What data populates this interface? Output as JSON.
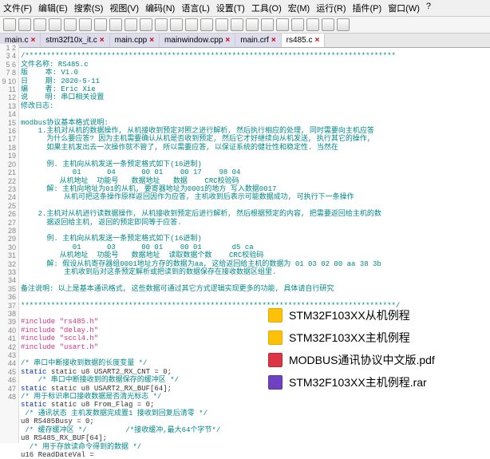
{
  "menu": {
    "file": "文件(F)",
    "edit": "编辑(E)",
    "search": "搜索(S)",
    "view": "视图(V)",
    "encoding": "编码(N)",
    "language": "语言(L)",
    "settings": "设置(T)",
    "tools": "工具(O)",
    "macro": "宏(M)",
    "run": "运行(R)",
    "plugin": "插件(P)",
    "window": "窗口(W)",
    "help": "?"
  },
  "tabs": [
    {
      "label": "main.c"
    },
    {
      "label": "stm32f10x_it.c"
    },
    {
      "label": "main.cpp"
    },
    {
      "label": "mainwindow.cpp"
    },
    {
      "label": "main.crf"
    },
    {
      "label": "rs485.c",
      "active": true
    }
  ],
  "code": {
    "header_line": "/**************************************************************************************",
    "h1": "文件名称: RS485.c",
    "h2": "版    本: V1.0",
    "h3": "日    期: 2020-5-11",
    "h4": "编    者: Eric Xie",
    "h5": "说    明: 串口相关设置",
    "h6": "修改日志:",
    "hm1": "modbus协议基本格式说明:",
    "hm2": "    1.主机对从机的数据操作, 从机接收到预定对照之进行解析, 然后执行相应的处理, 同时需要向主机应答",
    "hm3": "      为什么要应答? 因为主机需要确认从机是否收到预定, 然后它才好继续向从机发送, 执行其它的操作,",
    "hm4": "      如果主机发出去一次操作就不管了, 所以需要应答, 以保证系统的健壮性和稳定性. 当然在",
    "hm6": "      例. 主机向从机发送一条预定格式如下(16进制)",
    "hm7": "            01      04      00 01    00 17    98 04",
    "hm8": "         从机地址  功能号   数据地址   数据    CRC校验码",
    "hm9": "      解: 主机向地址为01的从机, 要寄器地址为0001的地方 写入数据0017",
    "hm10": "          从机可把这条操作原样返回因作为应答, 主机收到后表示可能数据成功, 可执行下一条操作",
    "hm11": "    2.主机对从机进行读数据操作, 从机接收到预定后进行解析, 然后根据预定的内容, 把需要返回给主机的数",
    "hm12": "      据返回给主机, 返回的预定即同等于应答.",
    "hm13": "      例. 主机向从机发送一条预定格式如下(16进制)",
    "hm14": "            01      03      00 01    00 01       d5 ca",
    "hm15": "         从机地址  功能号   数据地址  读取数据个数    CRC校验码",
    "hm16": "      解: 假设从机寄存器组0001地址方存的数据为aa, 这给返回给主机的数据为 01 03 02 00 aa 38 3b",
    "hm17": "          主机收到后对这条预定解析或把读到的数据保存在接收数据区组里.",
    "hm18": "备注说明: 以上是基本通讯格式, 这些数据可通过其它方式逻辑实现更多的功能, 具体请自行研究",
    "header_end": "***************************************************************************************/",
    "inc1": "#include \"rs485.h\"",
    "inc2": "#include \"delay.h\"",
    "inc3": "#include \"sccl4.h\"",
    "inc4": "#include \"usart.h\"",
    "c1": "/* 串口中断接收到数据的长度变量 */",
    "v1": "static u8 USART2_RX_CNT = 0;",
    "c2": "    /* 串口中断接收到的数据保存的缓冲区 */",
    "v2": "static u8 USART2_RX_BUF[64];",
    "c3": "/* 用于标识串口接收数据是否清光标志 */",
    "v3": "static u8 From_Flag = 0;",
    "c4": " /* 通讯状态 主机发数据完成置1 接收到回复后清零 */",
    "v4": "u8 RS485Busy = 0;",
    "c5": " /* 缓存缓冲区 */         /*接收缓冲,最大64个字节*/",
    "v5": "u8 RS485_RX_BUF[64];",
    "c6": "  /* 用于存放读命令得到的数据 */",
    "v6": "u16 ReadDateVal = ",
    "key_static": "static",
    "key_u8": "u8",
    "key_u16": "u16"
  },
  "files": [
    {
      "icon": "folder",
      "name": "STM32F103XX从机例程"
    },
    {
      "icon": "folder",
      "name": "STM32F103XX主机例程"
    },
    {
      "icon": "pdf",
      "name": "MODBUS通讯协议中文版.pdf"
    },
    {
      "icon": "rar",
      "name": "STM32F103XX主机例程.rar"
    }
  ]
}
